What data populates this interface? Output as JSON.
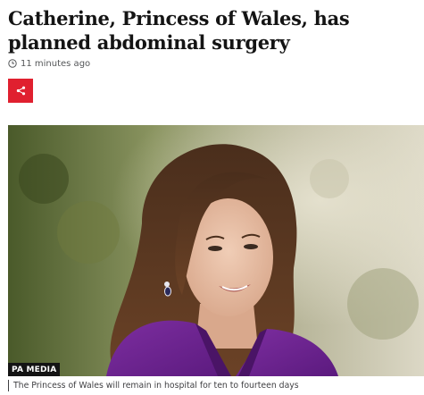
{
  "article": {
    "headline": "Catherine, Princess of Wales, has planned abdominal surgery",
    "timestamp": "11 minutes ago",
    "timestamp_icon": "clock-icon",
    "share_icon": "share-icon",
    "accent_color": "#e0202f"
  },
  "image": {
    "credit": "PA MEDIA",
    "caption": "The Princess of Wales will remain in hospital for ten to fourteen days"
  }
}
